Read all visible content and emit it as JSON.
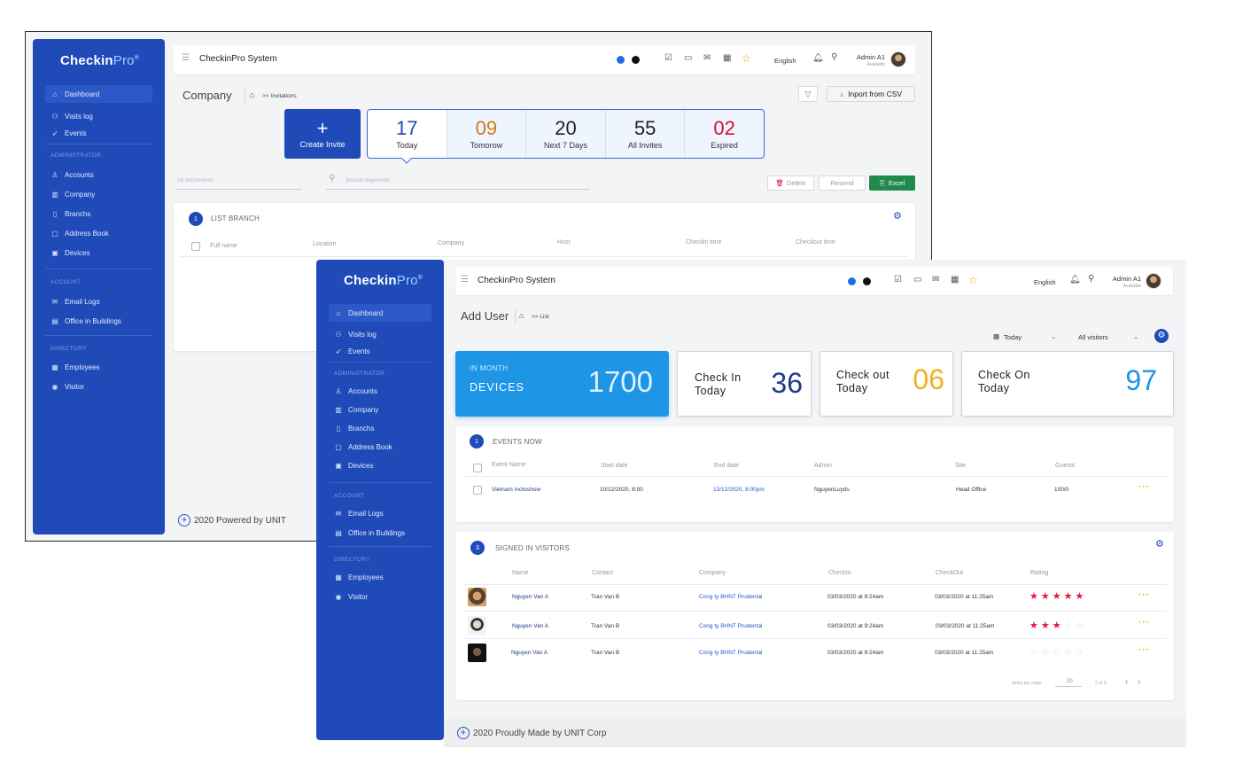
{
  "brand": {
    "name": "CheckinPro"
  },
  "colors": {
    "primary": "#1f4ab8",
    "accent_orange": "#d07a18",
    "accent_red": "#d4102a",
    "accent_sky": "#1f95e5",
    "excel_green": "#1f8a4c",
    "star_red": "#e3173d"
  },
  "sidebar": {
    "items": [
      {
        "label": "Dashboard",
        "icon": "home-icon"
      },
      {
        "label": "Visits log",
        "icon": "visitors-icon"
      },
      {
        "label": "Events",
        "icon": "rocket-icon"
      }
    ],
    "sections": {
      "administrator": "ADMINISTRATOR",
      "account": "ACCOUNT",
      "directory": "DIRECTORY"
    },
    "admin_items": [
      {
        "label": "Accounts",
        "icon": "user-icon"
      },
      {
        "label": "Company",
        "icon": "building-icon"
      },
      {
        "label": "Branchs",
        "icon": "branch-icon"
      },
      {
        "label": "Address Book",
        "icon": "book-icon"
      },
      {
        "label": "Devices",
        "icon": "device-icon"
      }
    ],
    "account_items": [
      {
        "label": "Email Logs",
        "icon": "mail-icon"
      },
      {
        "label": "Office in Buildings",
        "icon": "office-icon"
      }
    ],
    "directory_items": [
      {
        "label": "Employees",
        "icon": "employees-icon"
      },
      {
        "label": "Visitor",
        "icon": "visitor-icon"
      }
    ]
  },
  "topbar": {
    "title": "CheckinPro System",
    "language": "English",
    "admin_name": "Admin A1",
    "admin_status": "Available"
  },
  "page1": {
    "title": "Company",
    "crumb": ">> Invitations",
    "import_btn": "Inport from CSV",
    "create_invite": "Create Invite",
    "stats": [
      {
        "value": "17",
        "label": "Today",
        "color": "#1f4ab8"
      },
      {
        "value": "09",
        "label": "Tomorow",
        "color": "#d07a18"
      },
      {
        "value": "20",
        "label": "Next 7 Days",
        "color": "#222222"
      },
      {
        "value": "55",
        "label": "All Invites",
        "color": "#222222"
      },
      {
        "value": "02",
        "label": "Expired",
        "color": "#d4102a"
      }
    ],
    "docs_placeholder": "All documents",
    "search_placeholder": "Search keywords",
    "btn_delete": "Delete",
    "btn_resend": "Resend",
    "btn_excel": "Excel",
    "list_num": "1",
    "list_title": "LIST BRANCH",
    "columns": [
      "Full name",
      "Location",
      "Company",
      "Host",
      "Checkin time",
      "Checkout time"
    ],
    "footer": "2020 Powered by UNIT"
  },
  "page2": {
    "title": "Add User",
    "crumb": ">> List",
    "filter_date": "Today",
    "filter_visitors": "All visitors",
    "kpi_devices": {
      "line1": "IN MONTH",
      "line2": "DEVICES",
      "value": "1700"
    },
    "kpi_checkin": {
      "line1": "Check In",
      "line2": "Today",
      "value": "36"
    },
    "kpi_checkout": {
      "line1": "Check out",
      "line2": "Today",
      "value": "06"
    },
    "kpi_checkon": {
      "line1": "Check On",
      "line2": "Today",
      "value": "97"
    },
    "events": {
      "num": "1",
      "title": "EVENTS NOW",
      "columns": [
        "Event Name",
        "Start date",
        "End date",
        "Admin",
        "Site",
        "Guests"
      ],
      "rows": [
        {
          "name": "Vietnam motoshow",
          "start": "10/12/2020, 8:00",
          "end": "13/12/2020, 8:00pm",
          "admin": "NguyenLuyds",
          "site": "Head Office",
          "guests": "100/0"
        }
      ]
    },
    "visitors": {
      "num": "3",
      "title": "SIGNED IN VISITORS",
      "columns": [
        "Name",
        "Contact",
        "Company",
        "CheckIn",
        "CheckOut",
        "Rating"
      ],
      "rows": [
        {
          "name": "Nguyen Van A",
          "contact": "Tran Van B",
          "company": "Cong ty BHNT Prudental",
          "checkin": "03/03/2020 at 9:24am",
          "checkout": "03/03/2020 at 11:25am",
          "rating": 5
        },
        {
          "name": "Nguyen Van A",
          "contact": "Tran Van B",
          "company": "Cong ty BHNT Prudental",
          "checkin": "03/03/2020 at 9:24am",
          "checkout": "03/03/2020 at 11:25am",
          "rating": 3
        },
        {
          "name": "Nguyen Van A",
          "contact": "Tran Van B",
          "company": "Cong ty BHNT Prudental",
          "checkin": "03/03/2020 at 9:24am",
          "checkout": "03/03/2020 at 11:25am",
          "rating": 0
        }
      ],
      "pager": {
        "items_label": "Items per page",
        "per_page": "20",
        "range": "3 of 3"
      }
    },
    "footer": "2020 Proudly Made by UNIT Corp"
  }
}
